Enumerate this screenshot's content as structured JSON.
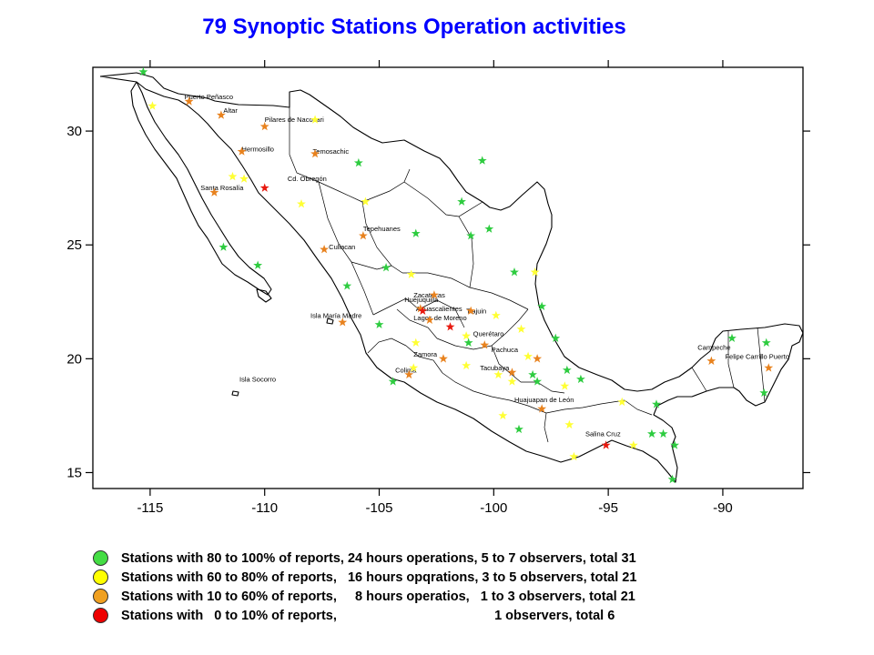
{
  "title": "79 Synoptic Stations Operation activities",
  "axes": {
    "x_ticks": [
      {
        "value": -115,
        "label": "-115"
      },
      {
        "value": -110,
        "label": "-110"
      },
      {
        "value": -105,
        "label": "-105"
      },
      {
        "value": -100,
        "label": "-100"
      },
      {
        "value": -95,
        "label": "-95"
      },
      {
        "value": -90,
        "label": "-90"
      }
    ],
    "y_ticks": [
      {
        "value": 30,
        "label": "30"
      },
      {
        "value": 25,
        "label": "25"
      },
      {
        "value": 20,
        "label": "20"
      },
      {
        "value": 15,
        "label": "15"
      }
    ],
    "lon_range": [
      -117.5,
      -86.5
    ],
    "lat_range": [
      14.3,
      32.8
    ]
  },
  "colors": {
    "green": "#2ecc40",
    "yellow": "#ffff33",
    "orange": "#e8821e",
    "red": "#e8190f",
    "legend_green": "#44dd44",
    "legend_yellow": "#ffff00",
    "legend_orange": "#f0a020",
    "legend_red": "#ee0000",
    "title": "#0000ff"
  },
  "places": [
    {
      "name": "Puerto Peñasco",
      "lon": -113.5,
      "lat": 31.4
    },
    {
      "name": "Altar",
      "lon": -111.8,
      "lat": 30.8
    },
    {
      "name": "Pilares de Nacozari",
      "lon": -110.0,
      "lat": 30.4
    },
    {
      "name": "Hermosillo",
      "lon": -111.0,
      "lat": 29.1
    },
    {
      "name": "Temosachic",
      "lon": -107.9,
      "lat": 29.0
    },
    {
      "name": "Cd. Obregón",
      "lon": -109.0,
      "lat": 27.8
    },
    {
      "name": "Santa Rosalía",
      "lon": -112.8,
      "lat": 27.4
    },
    {
      "name": "Tepehuanes",
      "lon": -105.7,
      "lat": 25.6
    },
    {
      "name": "Culiacan",
      "lon": -107.2,
      "lat": 24.8
    },
    {
      "name": "Zacatecas",
      "lon": -103.5,
      "lat": 22.7
    },
    {
      "name": "Tlajuin",
      "lon": -101.2,
      "lat": 22.0
    },
    {
      "name": "Aguascalientes",
      "lon": -103.4,
      "lat": 22.1
    },
    {
      "name": "Huejuquilla",
      "lon": -103.9,
      "lat": 22.5
    },
    {
      "name": "Lagos de Moreno",
      "lon": -103.5,
      "lat": 21.7
    },
    {
      "name": "Isla María Madre",
      "lon": -108.0,
      "lat": 21.8
    },
    {
      "name": "Querétaro",
      "lon": -100.9,
      "lat": 21.0
    },
    {
      "name": "Pachuca",
      "lon": -100.1,
      "lat": 20.3
    },
    {
      "name": "Zamora",
      "lon": -103.5,
      "lat": 20.1
    },
    {
      "name": "Tacubaya",
      "lon": -100.6,
      "lat": 19.5
    },
    {
      "name": "Colima",
      "lon": -104.3,
      "lat": 19.4
    },
    {
      "name": "Isla Socorro",
      "lon": -111.1,
      "lat": 19.0
    },
    {
      "name": "Huajuapan de León",
      "lon": -99.1,
      "lat": 18.1
    },
    {
      "name": "Salina Cruz",
      "lon": -96.0,
      "lat": 16.6
    },
    {
      "name": "Campeche",
      "lon": -91.1,
      "lat": 20.4
    },
    {
      "name": "Felipe Carrillo Puerto",
      "lon": -89.9,
      "lat": 20.0
    }
  ],
  "stations": [
    {
      "lon": -115.3,
      "lat": 32.6,
      "status": "green"
    },
    {
      "lon": -114.9,
      "lat": 31.1,
      "status": "yellow"
    },
    {
      "lon": -113.3,
      "lat": 31.3,
      "status": "orange"
    },
    {
      "lon": -111.9,
      "lat": 30.7,
      "status": "orange"
    },
    {
      "lon": -110.0,
      "lat": 30.2,
      "status": "orange"
    },
    {
      "lon": -107.8,
      "lat": 30.5,
      "status": "yellow"
    },
    {
      "lon": -111.0,
      "lat": 29.1,
      "status": "orange"
    },
    {
      "lon": -107.8,
      "lat": 29.0,
      "status": "orange"
    },
    {
      "lon": -105.9,
      "lat": 28.6,
      "status": "green"
    },
    {
      "lon": -100.5,
      "lat": 28.7,
      "status": "green"
    },
    {
      "lon": -111.4,
      "lat": 28.0,
      "status": "yellow"
    },
    {
      "lon": -110.9,
      "lat": 27.9,
      "status": "yellow"
    },
    {
      "lon": -110.0,
      "lat": 27.5,
      "status": "red"
    },
    {
      "lon": -112.2,
      "lat": 27.3,
      "status": "orange"
    },
    {
      "lon": -108.4,
      "lat": 26.8,
      "status": "yellow"
    },
    {
      "lon": -105.6,
      "lat": 26.9,
      "status": "yellow"
    },
    {
      "lon": -101.4,
      "lat": 26.9,
      "status": "green"
    },
    {
      "lon": -103.4,
      "lat": 25.5,
      "status": "green"
    },
    {
      "lon": -105.7,
      "lat": 25.4,
      "status": "orange"
    },
    {
      "lon": -101.0,
      "lat": 25.4,
      "status": "green"
    },
    {
      "lon": -100.2,
      "lat": 25.7,
      "status": "green"
    },
    {
      "lon": -111.8,
      "lat": 24.9,
      "status": "green"
    },
    {
      "lon": -107.4,
      "lat": 24.8,
      "status": "orange"
    },
    {
      "lon": -110.3,
      "lat": 24.1,
      "status": "green"
    },
    {
      "lon": -104.7,
      "lat": 24.0,
      "status": "green"
    },
    {
      "lon": -103.6,
      "lat": 23.7,
      "status": "yellow"
    },
    {
      "lon": -99.1,
      "lat": 23.8,
      "status": "green"
    },
    {
      "lon": -98.2,
      "lat": 23.8,
      "status": "yellow"
    },
    {
      "lon": -106.4,
      "lat": 23.2,
      "status": "green"
    },
    {
      "lon": -102.6,
      "lat": 22.8,
      "status": "orange"
    },
    {
      "lon": -103.2,
      "lat": 22.2,
      "status": "orange"
    },
    {
      "lon": -103.1,
      "lat": 22.1,
      "status": "red"
    },
    {
      "lon": -101.0,
      "lat": 22.1,
      "status": "orange"
    },
    {
      "lon": -97.9,
      "lat": 22.3,
      "status": "green"
    },
    {
      "lon": -99.9,
      "lat": 21.9,
      "status": "yellow"
    },
    {
      "lon": -102.8,
      "lat": 21.7,
      "status": "orange"
    },
    {
      "lon": -101.9,
      "lat": 21.4,
      "status": "red"
    },
    {
      "lon": -98.8,
      "lat": 21.3,
      "status": "yellow"
    },
    {
      "lon": -106.6,
      "lat": 21.6,
      "status": "orange"
    },
    {
      "lon": -105.0,
      "lat": 21.5,
      "status": "green"
    },
    {
      "lon": -101.2,
      "lat": 21.0,
      "status": "yellow"
    },
    {
      "lon": -100.4,
      "lat": 20.6,
      "status": "orange"
    },
    {
      "lon": -97.3,
      "lat": 20.9,
      "status": "green"
    },
    {
      "lon": -103.4,
      "lat": 20.7,
      "status": "yellow"
    },
    {
      "lon": -101.1,
      "lat": 20.7,
      "status": "green"
    },
    {
      "lon": -102.2,
      "lat": 20.0,
      "status": "orange"
    },
    {
      "lon": -98.5,
      "lat": 20.1,
      "status": "yellow"
    },
    {
      "lon": -98.1,
      "lat": 20.0,
      "status": "orange"
    },
    {
      "lon": -101.2,
      "lat": 19.7,
      "status": "yellow"
    },
    {
      "lon": -103.5,
      "lat": 19.6,
      "status": "yellow"
    },
    {
      "lon": -99.2,
      "lat": 19.4,
      "status": "orange"
    },
    {
      "lon": -99.8,
      "lat": 19.3,
      "status": "yellow"
    },
    {
      "lon": -98.3,
      "lat": 19.3,
      "status": "green"
    },
    {
      "lon": -96.8,
      "lat": 19.5,
      "status": "green"
    },
    {
      "lon": -103.7,
      "lat": 19.3,
      "status": "orange"
    },
    {
      "lon": -104.4,
      "lat": 19.0,
      "status": "green"
    },
    {
      "lon": -99.2,
      "lat": 19.0,
      "status": "yellow"
    },
    {
      "lon": -98.1,
      "lat": 19.0,
      "status": "green"
    },
    {
      "lon": -96.2,
      "lat": 19.1,
      "status": "green"
    },
    {
      "lon": -96.9,
      "lat": 18.8,
      "status": "yellow"
    },
    {
      "lon": -97.9,
      "lat": 17.8,
      "status": "orange"
    },
    {
      "lon": -99.6,
      "lat": 17.5,
      "status": "yellow"
    },
    {
      "lon": -94.4,
      "lat": 18.1,
      "status": "yellow"
    },
    {
      "lon": -92.9,
      "lat": 18.0,
      "status": "green"
    },
    {
      "lon": -96.7,
      "lat": 17.1,
      "status": "yellow"
    },
    {
      "lon": -98.9,
      "lat": 16.9,
      "status": "green"
    },
    {
      "lon": -93.1,
      "lat": 16.7,
      "status": "green"
    },
    {
      "lon": -92.6,
      "lat": 16.7,
      "status": "green"
    },
    {
      "lon": -93.9,
      "lat": 16.2,
      "status": "yellow"
    },
    {
      "lon": -95.1,
      "lat": 16.2,
      "status": "red"
    },
    {
      "lon": -92.1,
      "lat": 16.2,
      "status": "green"
    },
    {
      "lon": -96.5,
      "lat": 15.7,
      "status": "yellow"
    },
    {
      "lon": -92.2,
      "lat": 14.7,
      "status": "green"
    },
    {
      "lon": -90.5,
      "lat": 19.9,
      "status": "orange"
    },
    {
      "lon": -89.6,
      "lat": 20.9,
      "status": "green"
    },
    {
      "lon": -88.1,
      "lat": 20.7,
      "status": "green"
    },
    {
      "lon": -88.0,
      "lat": 19.6,
      "status": "orange"
    },
    {
      "lon": -88.2,
      "lat": 18.5,
      "status": "green"
    }
  ],
  "legend": [
    {
      "color_key": "legend_green",
      "text": "Stations with 80 to 100% of reports, 24 hours operations, 5 to 7 observers, total 31"
    },
    {
      "color_key": "legend_yellow",
      "text": "Stations with 60 to 80% of reports,   16 hours opqrations, 3 to 5 observers, total 21"
    },
    {
      "color_key": "legend_orange",
      "text": "Stations with 10 to 60% of reports,     8 hours operatios,   1 to 3 observers, total 21"
    },
    {
      "color_key": "legend_red",
      "text": "Stations with   0 to 10% of reports,                                           1 observers, total 6"
    }
  ]
}
